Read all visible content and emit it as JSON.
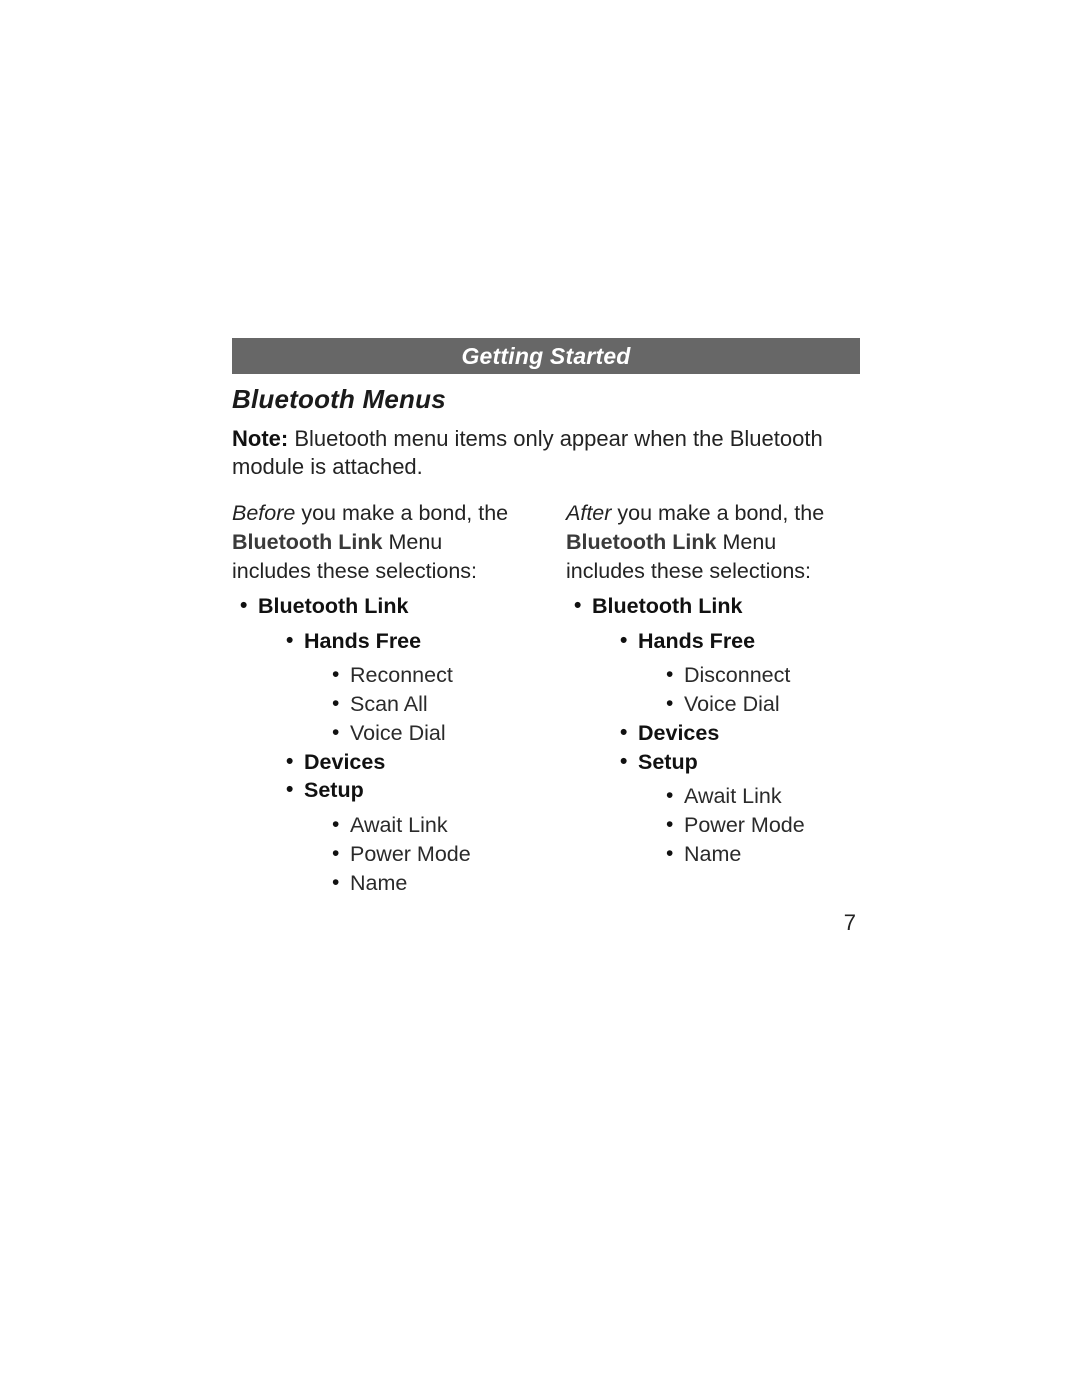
{
  "header": "Getting Started",
  "section_title": "Bluetooth Menus",
  "note_label": "Note:",
  "note_text": " Bluetooth menu items only appear when the Bluetooth module is attached.",
  "ui_menu_name": "Bluetooth Link",
  "intro_suffix": " Menu includes these selections:",
  "left": {
    "prefix": "Before",
    "prefix_rest": " you make a bond, the ",
    "root": "Bluetooth Link",
    "handsfree": "Hands Free",
    "hf_items": [
      "Reconnect",
      "Scan All",
      "Voice Dial"
    ],
    "devices": "Devices",
    "setup": "Setup",
    "setup_items": [
      "Await Link",
      "Power Mode",
      "Name"
    ]
  },
  "right": {
    "prefix": "After",
    "prefix_rest": " you make a bond, the ",
    "root": "Bluetooth Link",
    "handsfree": "Hands Free",
    "hf_items": [
      "Disconnect",
      "Voice Dial"
    ],
    "devices": "Devices",
    "setup": "Setup",
    "setup_items": [
      "Await Link",
      "Power Mode",
      "Name"
    ]
  },
  "page_number": "7"
}
